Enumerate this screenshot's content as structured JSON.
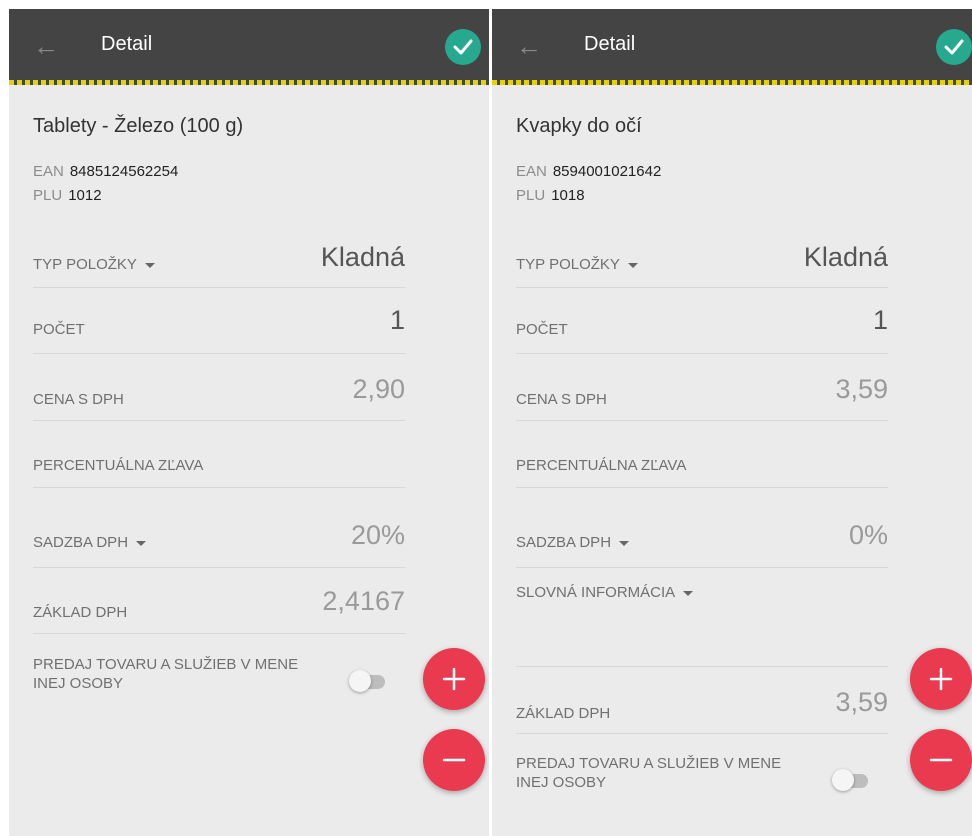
{
  "panels": [
    {
      "appbar": {
        "title": "Detail"
      },
      "product": {
        "name": "Tablety - Železo (100 g)",
        "ean_label": "EAN",
        "ean": "8485124562254",
        "plu_label": "PLU",
        "plu": "1012"
      },
      "fields": {
        "item_type": {
          "label": "TYP POLOŽKY",
          "value": "Kladná"
        },
        "quantity": {
          "label": "POČET",
          "value": "1"
        },
        "price": {
          "label": "CENA S DPH",
          "value": "2,90"
        },
        "discount": {
          "label": "PERCENTUÁLNA ZĽAVA",
          "value": ""
        },
        "vat_rate": {
          "label": "SADZBA DPH",
          "value": "20%"
        },
        "vat_base": {
          "label": "ZÁKLAD DPH",
          "value": "2,4167"
        }
      },
      "switch": {
        "label": "PREDAJ TOVARU A SLUŽIEB V MENE INEJ OSOBY",
        "on": false
      }
    },
    {
      "appbar": {
        "title": "Detail"
      },
      "product": {
        "name": "Kvapky do očí",
        "ean_label": "EAN",
        "ean": "8594001021642",
        "plu_label": "PLU",
        "plu": "1018"
      },
      "fields": {
        "item_type": {
          "label": "TYP POLOŽKY",
          "value": "Kladná"
        },
        "quantity": {
          "label": "POČET",
          "value": "1"
        },
        "price": {
          "label": "CENA S DPH",
          "value": "3,59"
        },
        "discount": {
          "label": "PERCENTUÁLNA ZĽAVA",
          "value": ""
        },
        "vat_rate": {
          "label": "SADZBA DPH",
          "value": "0%"
        },
        "verbal_info": {
          "label": "SLOVNÁ INFORMÁCIA",
          "value": ""
        },
        "vat_base": {
          "label": "ZÁKLAD DPH",
          "value": "3,59"
        }
      },
      "switch": {
        "label": "PREDAJ TOVARU A SLUŽIEB V MENE INEJ OSOBY",
        "on": false
      }
    }
  ],
  "colors": {
    "appbar": "#444444",
    "accent_stripe": "#e5d300",
    "confirm": "#27a98f",
    "fab": "#ea3a50",
    "background": "#ebebeb"
  },
  "icons": {
    "back": "arrow-left-icon",
    "confirm": "check-circle-icon",
    "add": "plus-icon",
    "remove": "minus-icon",
    "dropdown": "caret-down-icon"
  }
}
